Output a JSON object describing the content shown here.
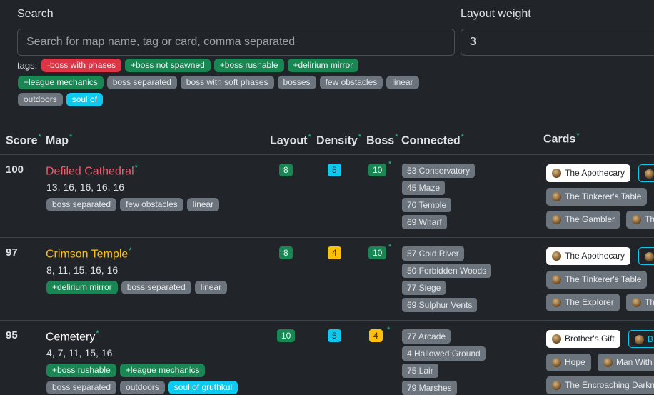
{
  "search": {
    "label": "Search",
    "placeholder": "Search for map name, tag or card, comma separated",
    "value": ""
  },
  "layout_weight": {
    "label": "Layout weight",
    "value": "3"
  },
  "tags_label": "tags:",
  "tags": [
    {
      "text": "-boss with phases",
      "color": "red"
    },
    {
      "text": "+boss not spawned",
      "color": "green"
    },
    {
      "text": "+boss rushable",
      "color": "green"
    },
    {
      "text": "+delirium mirror",
      "color": "green"
    },
    {
      "text": "+league mechanics",
      "color": "green"
    },
    {
      "text": "boss separated",
      "color": "gray"
    },
    {
      "text": "boss with soft phases",
      "color": "gray"
    },
    {
      "text": "bosses",
      "color": "gray"
    },
    {
      "text": "few obstacles",
      "color": "gray"
    },
    {
      "text": "linear",
      "color": "gray"
    },
    {
      "text": "outdoors",
      "color": "gray"
    },
    {
      "text": "soul of",
      "color": "cyan"
    }
  ],
  "columns": {
    "score": "Score",
    "map": "Map",
    "layout": "Layout",
    "density": "Density",
    "boss": "Boss",
    "connected": "Connected",
    "cards": "Cards"
  },
  "rows": [
    {
      "score": "100",
      "name": "Defiled Cathedral",
      "name_color": "#dc3545",
      "levels": "13, 16, 16, 16, 16",
      "tags": [
        [
          "boss separated",
          "few obstacles",
          "linear"
        ]
      ],
      "layout": "8",
      "density": "5",
      "boss": "10",
      "connected": [
        "53 Conservatory",
        "45 Maze",
        "70 Temple",
        "69 Wharf"
      ],
      "cards": [
        [
          "The Apothecary",
          "The Tinkerer's Table",
          "The Gambler",
          "Th"
        ]
      ]
    },
    {
      "score": "97",
      "name": "Crimson Temple",
      "name_color": "#ffc107",
      "levels": "8, 11, 15, 16, 16",
      "tags": [
        [
          "+delirium mirror",
          "boss separated",
          "linear"
        ]
      ],
      "layout": "8",
      "density": "4",
      "boss": "10",
      "connected": [
        "57 Cold River",
        "50 Forbidden Woods",
        "77 Siege",
        "69 Sulphur Vents"
      ],
      "cards": [
        [
          "The Apothecary",
          "The Tinkerer's Table",
          "The Explorer",
          "Th"
        ]
      ]
    },
    {
      "score": "95",
      "name": "Cemetery",
      "name_color": "#ffffff",
      "levels": "4, 7, 11, 15, 16",
      "tags": [
        [
          "+boss rushable",
          "+league mechanics"
        ],
        [
          "boss separated",
          "outdoors",
          "soul of gruthkul"
        ]
      ],
      "layout": "10",
      "density": "5",
      "boss": "4",
      "connected": [
        "77 Arcade",
        "4 Hallowed Ground",
        "75 Lair",
        "79 Marshes"
      ],
      "cards": [
        [
          "Brother's Gift",
          "B",
          "Hope",
          "Man With",
          "The Encroaching Darkn"
        ]
      ]
    }
  ]
}
